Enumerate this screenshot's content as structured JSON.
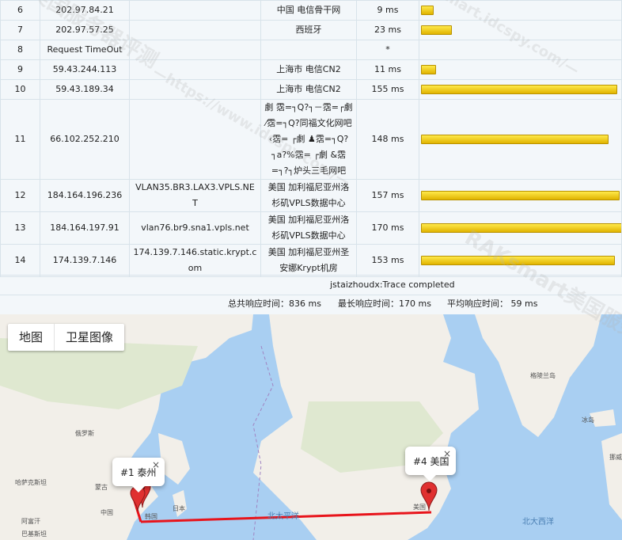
{
  "hops": [
    {
      "num": "6",
      "ip": "202.97.84.21",
      "host": "",
      "location": "中国 电信骨干网",
      "time": "9 ms",
      "ms": 9
    },
    {
      "num": "7",
      "ip": "202.97.57.25",
      "host": "",
      "location": "西班牙",
      "time": "23 ms",
      "ms": 23
    },
    {
      "num": "8",
      "ip": "Request TimeOut",
      "host": "",
      "location": "",
      "time": "*",
      "ms": 0
    },
    {
      "num": "9",
      "ip": "59.43.244.113",
      "host": "",
      "location": "上海市 电信CN2",
      "time": "11 ms",
      "ms": 11
    },
    {
      "num": "10",
      "ip": "59.43.189.34",
      "host": "",
      "location": "上海市 电信CN2",
      "time": "155 ms",
      "ms": 155
    },
    {
      "num": "11",
      "ip": "66.102.252.210",
      "host": "",
      "location": "劇 霑=┐Q?┐－霑=┌劇 ⁄霑=┐Q?同福文化网吧 ‹霑= ┌劇 ♟霑=┐Q?┐a?%霑= ┌劇 &霑=┐?┐炉头三毛网吧",
      "time": "148 ms",
      "ms": 148
    },
    {
      "num": "12",
      "ip": "184.164.196.236",
      "host": "VLAN35.BR3.LAX3.VPLS.NET",
      "location": "美国 加利福尼亚州洛杉矶VPLS数据中心",
      "time": "157 ms",
      "ms": 157
    },
    {
      "num": "13",
      "ip": "184.164.197.91",
      "host": "vlan76.br9.sna1.vpls.net",
      "location": "美国 加利福尼亚州洛杉矶VPLS数据中心",
      "time": "170 ms",
      "ms": 170
    },
    {
      "num": "14",
      "ip": "174.139.7.146",
      "host": "174.139.7.146.static.krypt.com",
      "location": "美国 加利福尼亚州圣安娜Krypt机房",
      "time": "153 ms",
      "ms": 153
    }
  ],
  "completed_text": "jstaizhoudx:Trace completed",
  "summary": {
    "total": "总共响应时间：836 ms",
    "max": "最长响应时间：170 ms",
    "avg": "平均响应时间： 59 ms"
  },
  "map": {
    "tab_map": "地图",
    "tab_satellite": "卫星图像",
    "marker1_label": "#1 泰州",
    "marker4_label": "#4 美国",
    "close_glyph": "×",
    "route_color": "#e8141b",
    "place_labels": [
      "格陵兰岛",
      "冰岛",
      "俄罗斯",
      "蒙古",
      "哈萨克斯坦",
      "中国",
      "日本",
      "韩国",
      "阿富汗",
      "巴基斯坦",
      "美国",
      "挪威"
    ],
    "ocean_labels": [
      "北太平洋",
      "北大西洋"
    ]
  },
  "watermarks": [
    "美国服务器评测",
    "—https://www.idcspy.com/—",
    "RAKsmart美国服务",
    "smart.idcspy.com/—"
  ]
}
